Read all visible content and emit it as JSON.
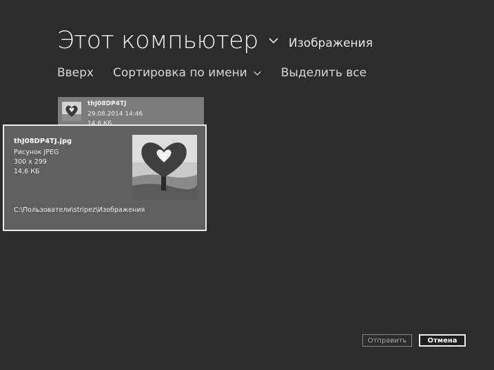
{
  "header": {
    "location": "Этот компьютер",
    "folder": "Изображения"
  },
  "commands": {
    "up": "Вверх",
    "sort": "Сортировка по имени",
    "select_all": "Выделить все"
  },
  "file_tile": {
    "name": "thJ08DP4TJ",
    "date": "29.08.2014 14:46",
    "size": "14,6 КБ"
  },
  "tooltip": {
    "filename": "thJ08DP4TJ.jpg",
    "type": "Рисунок JPEG",
    "dimensions": "300 x 299",
    "size": "14,6 КБ",
    "path": "C:\\Пользователи\\stripez\\Изображения"
  },
  "buttons": {
    "send": "Отправить",
    "cancel": "Отмена"
  }
}
